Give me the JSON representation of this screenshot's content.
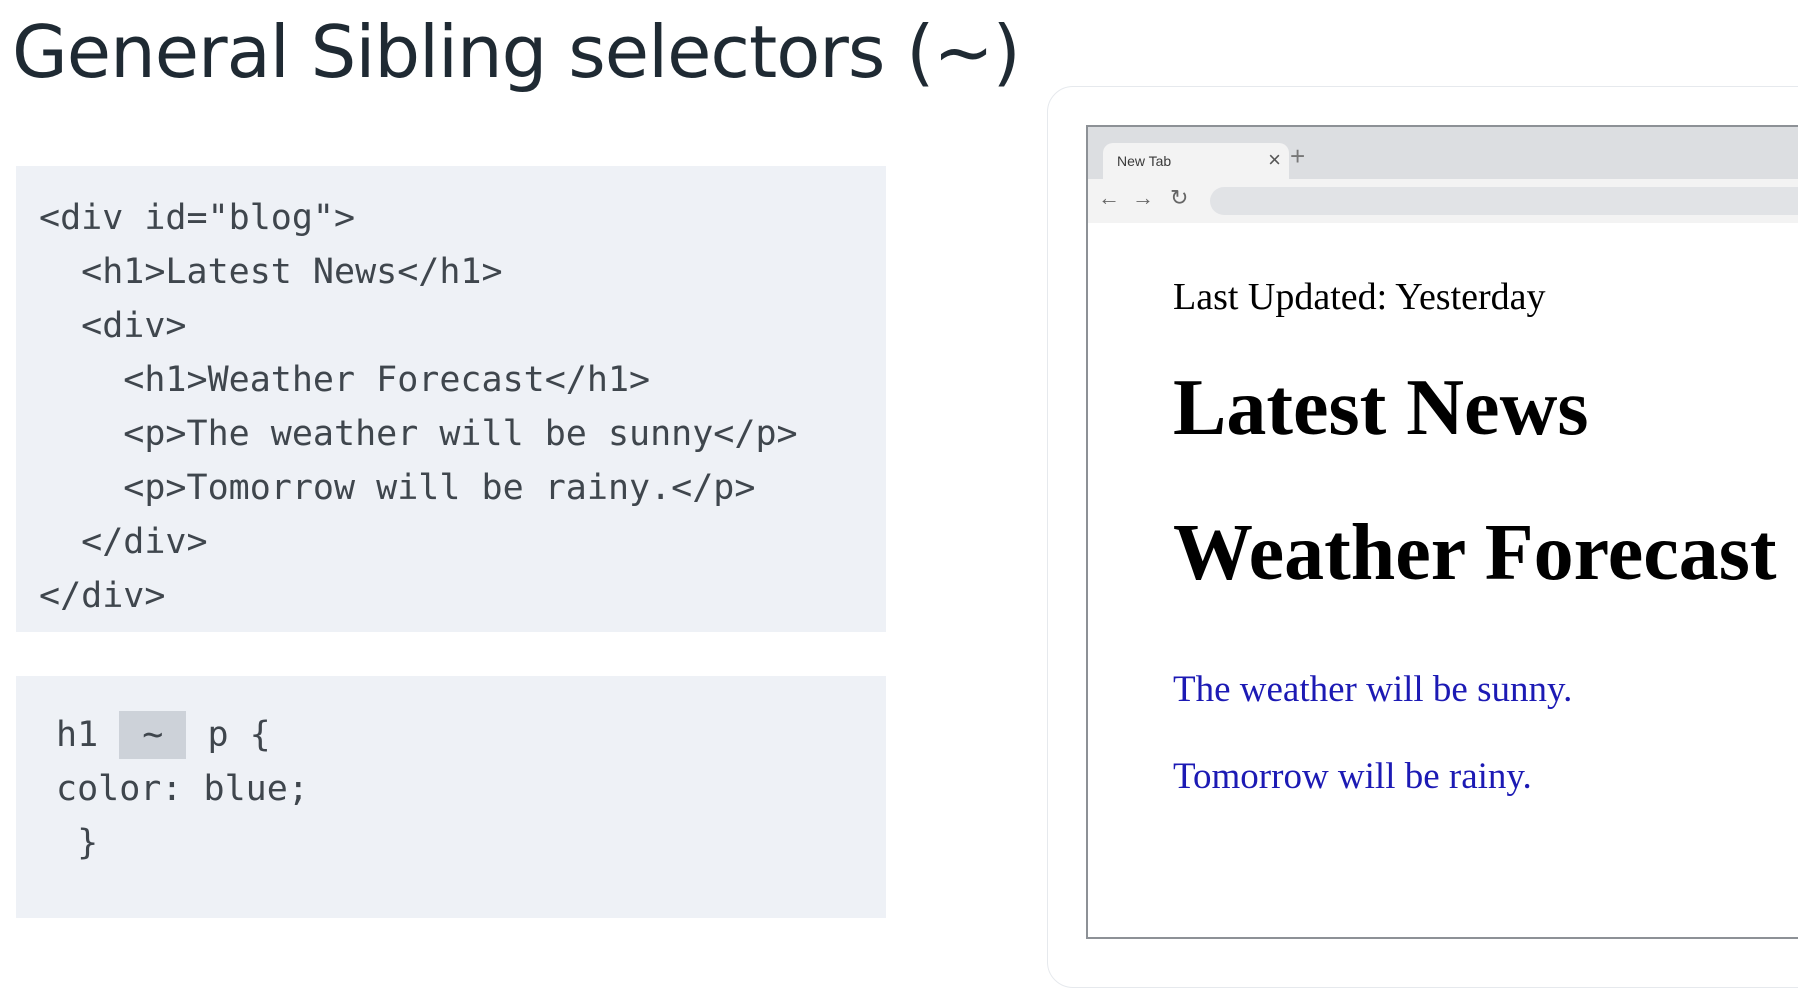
{
  "slide": {
    "title": "General Sibling selectors (~)"
  },
  "html_code": {
    "lines": [
      "<div id=\"blog\">",
      "  <h1>Latest News</h1>",
      "  <div>",
      "    <h1>Weather Forecast</h1>",
      "    <p>The weather will be sunny</p>",
      "    <p>Tomorrow will be rainy.</p>",
      "  </div>",
      "</div>"
    ]
  },
  "css_code": {
    "selector_left": "h1 ",
    "combinator": " ~ ",
    "selector_right": " p {",
    "line2": "color: blue;",
    "line3": " }"
  },
  "browser": {
    "tab_label": "New Tab",
    "tab_close_icon": "×",
    "new_tab_icon": "+",
    "back_icon": "←",
    "forward_icon": "→",
    "reload_icon": "↻",
    "address": "",
    "content": {
      "updated": "Last Updated: Yesterday",
      "heading1": "Latest News",
      "heading2": "Weather Forecast",
      "para1": "The weather will be sunny.",
      "para2": "Tomorrow will be rainy."
    }
  },
  "colors": {
    "blue_text": "#1c1ab4",
    "code_bg": "#eef1f6",
    "title": "#1f2a33"
  }
}
